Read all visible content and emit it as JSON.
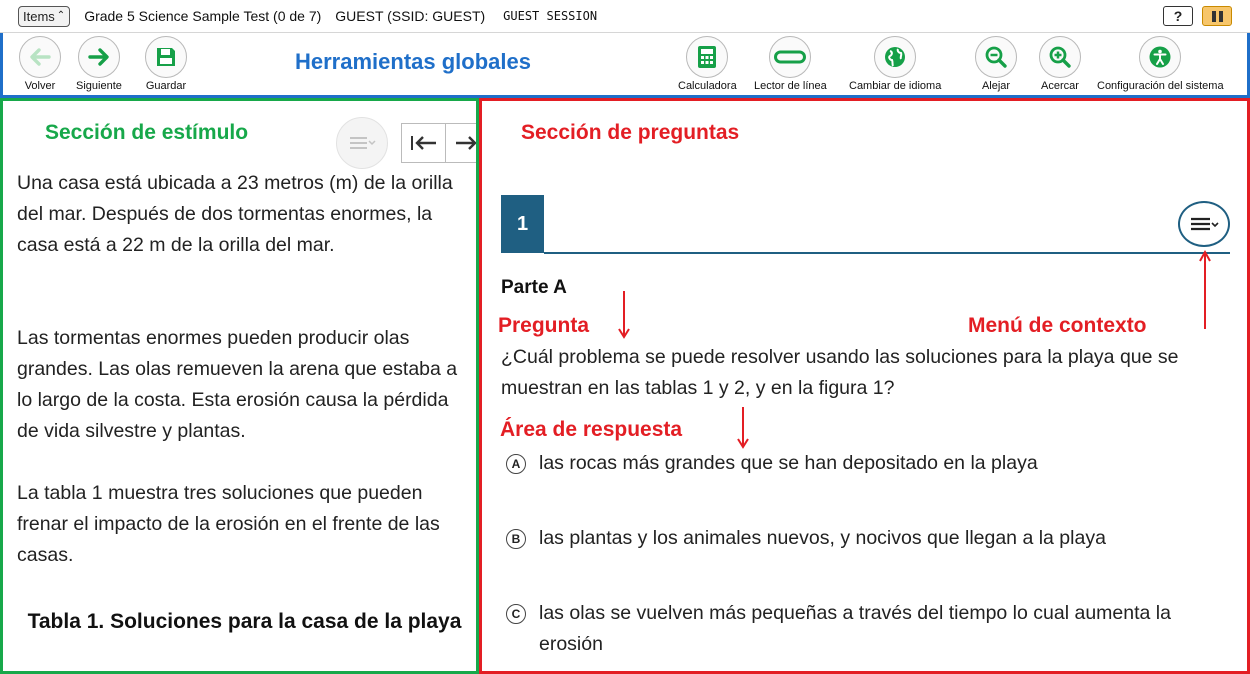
{
  "topbar": {
    "items_label": "Items",
    "test_title": "Grade 5 Science Sample Test (0 de 7)",
    "guest_info": "GUEST (SSID: GUEST)",
    "session": "GUEST SESSION",
    "help_label": "?"
  },
  "toolbar": {
    "title": "Herramientas globales",
    "back_label": "Volver",
    "next_label": "Siguiente",
    "save_label": "Guardar",
    "calculator_label": "Calculadora",
    "line_reader_label": "Lector de línea",
    "language_label": "Cambiar de idioma",
    "zoom_out_label": "Alejar",
    "zoom_in_label": "Acercar",
    "settings_label": "Configuración del sistema",
    "accent_color": "#1f6fc9"
  },
  "stimulus": {
    "section_label": "Sección de estímulo",
    "frame_color": "#17a84a",
    "paragraphs": [
      "Una casa está ubicada a 23 metros (m) de la orilla del mar. Después de dos tormentas enormes, la casa está a 22 m de la orilla del mar.",
      "Las tormentas enormes pueden producir olas grandes. Las olas remueven la arena que estaba a lo largo de la costa. Esta erosión causa la pérdida de vida silvestre y plantas.",
      "La tabla 1 muestra tres soluciones que pueden frenar el impacto de la erosión en el frente de las casas."
    ],
    "table_title": "Tabla 1. Soluciones para la casa de la playa"
  },
  "question": {
    "section_label": "Sección de preguntas",
    "frame_color": "#e31e24",
    "number": "1",
    "part": "Parte A",
    "annotation_question": "Pregunta",
    "annotation_context_menu": "Menú de contexto",
    "annotation_answer_area": "Área de respuesta",
    "text": "¿Cuál problema se puede resolver usando las soluciones para la playa que se muestran en las tablas 1 y 2, y en la figura 1?",
    "options": [
      {
        "letter": "A",
        "text": "las rocas más grandes que se han depositado en la playa"
      },
      {
        "letter": "B",
        "text": "las plantas y los animales nuevos, y nocivos que llegan a la playa"
      },
      {
        "letter": "C",
        "text": "las olas se vuelven más pequeñas a través del tiempo lo cual aumenta la erosión"
      }
    ]
  }
}
